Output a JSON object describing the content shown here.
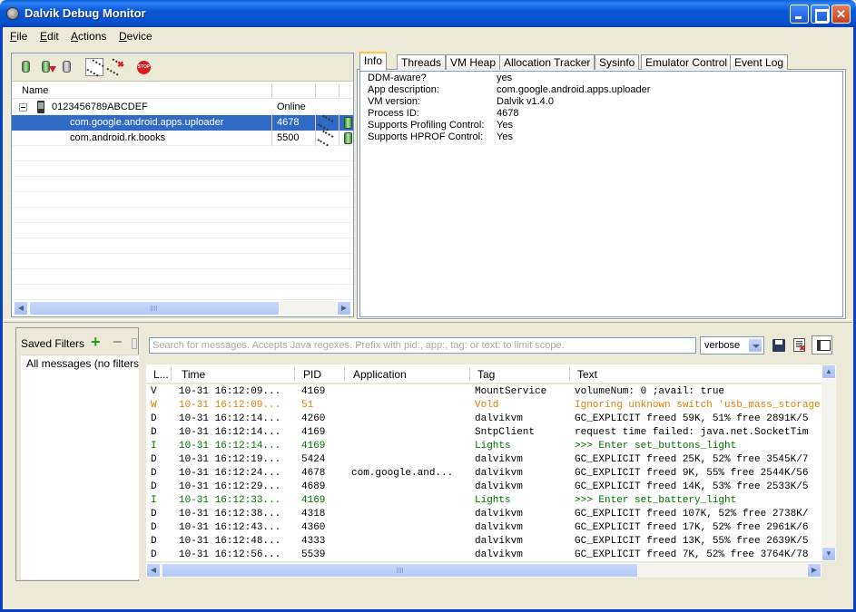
{
  "window": {
    "title": "Dalvik Debug Monitor"
  },
  "menu": [
    {
      "mnemonic": "F",
      "rest": "ile"
    },
    {
      "mnemonic": "E",
      "rest": "dit"
    },
    {
      "mnemonic": "A",
      "rest": "ctions"
    },
    {
      "mnemonic": "D",
      "rest": "evice"
    }
  ],
  "devices": {
    "header": {
      "name": "Name"
    },
    "device": {
      "serial": "0123456789ABCDEF",
      "status": "Online"
    },
    "clients": [
      {
        "name": "com.google.android.apps.uploader",
        "pid": "4678",
        "selected": true
      },
      {
        "name": "com.android.rk.books",
        "pid": "5500",
        "selected": false
      }
    ]
  },
  "tabs": [
    "Info",
    "Threads",
    "VM Heap",
    "Allocation Tracker",
    "Sysinfo",
    "Emulator Control",
    "Event Log"
  ],
  "info": [
    {
      "key": "DDM-aware?",
      "value": "yes"
    },
    {
      "key": "App description:",
      "value": "com.google.android.apps.uploader"
    },
    {
      "key": "VM version:",
      "value": "Dalvik v1.4.0"
    },
    {
      "key": "Process ID:",
      "value": "4678"
    },
    {
      "key": "Supports Profiling Control:",
      "value": "Yes"
    },
    {
      "key": "Supports HPROF Control:",
      "value": "Yes"
    }
  ],
  "filters": {
    "label": "Saved Filters",
    "add_symbol": "+",
    "remove_symbol": "−",
    "items": [
      "All messages (no filters)"
    ]
  },
  "logcat": {
    "search_placeholder": "Search for messages. Accepts Java regexes. Prefix with pid:, app:, tag: or text: to limit scope.",
    "level": "verbose",
    "columns": [
      "L...",
      "Time",
      "PID",
      "Application",
      "Tag",
      "Text"
    ],
    "level_colors": {
      "V": "#000000",
      "D": "#000000",
      "I": "#007000",
      "W": "#e08000"
    },
    "rows": [
      {
        "level": "V",
        "time": "10-31 16:12:09...",
        "pid": "4169",
        "app": "",
        "tag": "MountService",
        "text": "volumeNum: 0 ;avail: true"
      },
      {
        "level": "W",
        "time": "10-31 16:12:09...",
        "pid": "51",
        "app": "",
        "tag": "Vold",
        "text": "Ignoring unknown switch 'usb_mass_storage'"
      },
      {
        "level": "D",
        "time": "10-31 16:12:14...",
        "pid": "4260",
        "app": "",
        "tag": "dalvikvm",
        "text": "GC_EXPLICIT freed 59K, 51% free 2891K/5"
      },
      {
        "level": "D",
        "time": "10-31 16:12:14...",
        "pid": "4169",
        "app": "",
        "tag": "SntpClient",
        "text": "request time failed: java.net.SocketTim"
      },
      {
        "level": "I",
        "time": "10-31 16:12:14...",
        "pid": "4169",
        "app": "",
        "tag": "Lights",
        "text": ">>> Enter set_buttons_light"
      },
      {
        "level": "D",
        "time": "10-31 16:12:19...",
        "pid": "5424",
        "app": "",
        "tag": "dalvikvm",
        "text": "GC_EXPLICIT freed 25K, 52% free 3545K/7"
      },
      {
        "level": "D",
        "time": "10-31 16:12:24...",
        "pid": "4678",
        "app": "com.google.and...",
        "tag": "dalvikvm",
        "text": "GC_EXPLICIT freed 9K, 55% free 2544K/56"
      },
      {
        "level": "D",
        "time": "10-31 16:12:29...",
        "pid": "4689",
        "app": "",
        "tag": "dalvikvm",
        "text": "GC_EXPLICIT freed 14K, 53% free 2533K/5"
      },
      {
        "level": "I",
        "time": "10-31 16:12:33...",
        "pid": "4169",
        "app": "",
        "tag": "Lights",
        "text": ">>> Enter set_battery_light"
      },
      {
        "level": "D",
        "time": "10-31 16:12:38...",
        "pid": "4318",
        "app": "",
        "tag": "dalvikvm",
        "text": "GC_EXPLICIT freed 107K, 52% free 2738K/"
      },
      {
        "level": "D",
        "time": "10-31 16:12:43...",
        "pid": "4360",
        "app": "",
        "tag": "dalvikvm",
        "text": "GC_EXPLICIT freed 17K, 52% free 2961K/6"
      },
      {
        "level": "D",
        "time": "10-31 16:12:48...",
        "pid": "4333",
        "app": "",
        "tag": "dalvikvm",
        "text": "GC_EXPLICIT freed 13K, 55% free 2639K/5"
      },
      {
        "level": "D",
        "time": "10-31 16:12:56...",
        "pid": "5539",
        "app": "",
        "tag": "dalvikvm",
        "text": "GC_EXPLICIT freed 7K, 52% free 3764K/78"
      }
    ]
  }
}
